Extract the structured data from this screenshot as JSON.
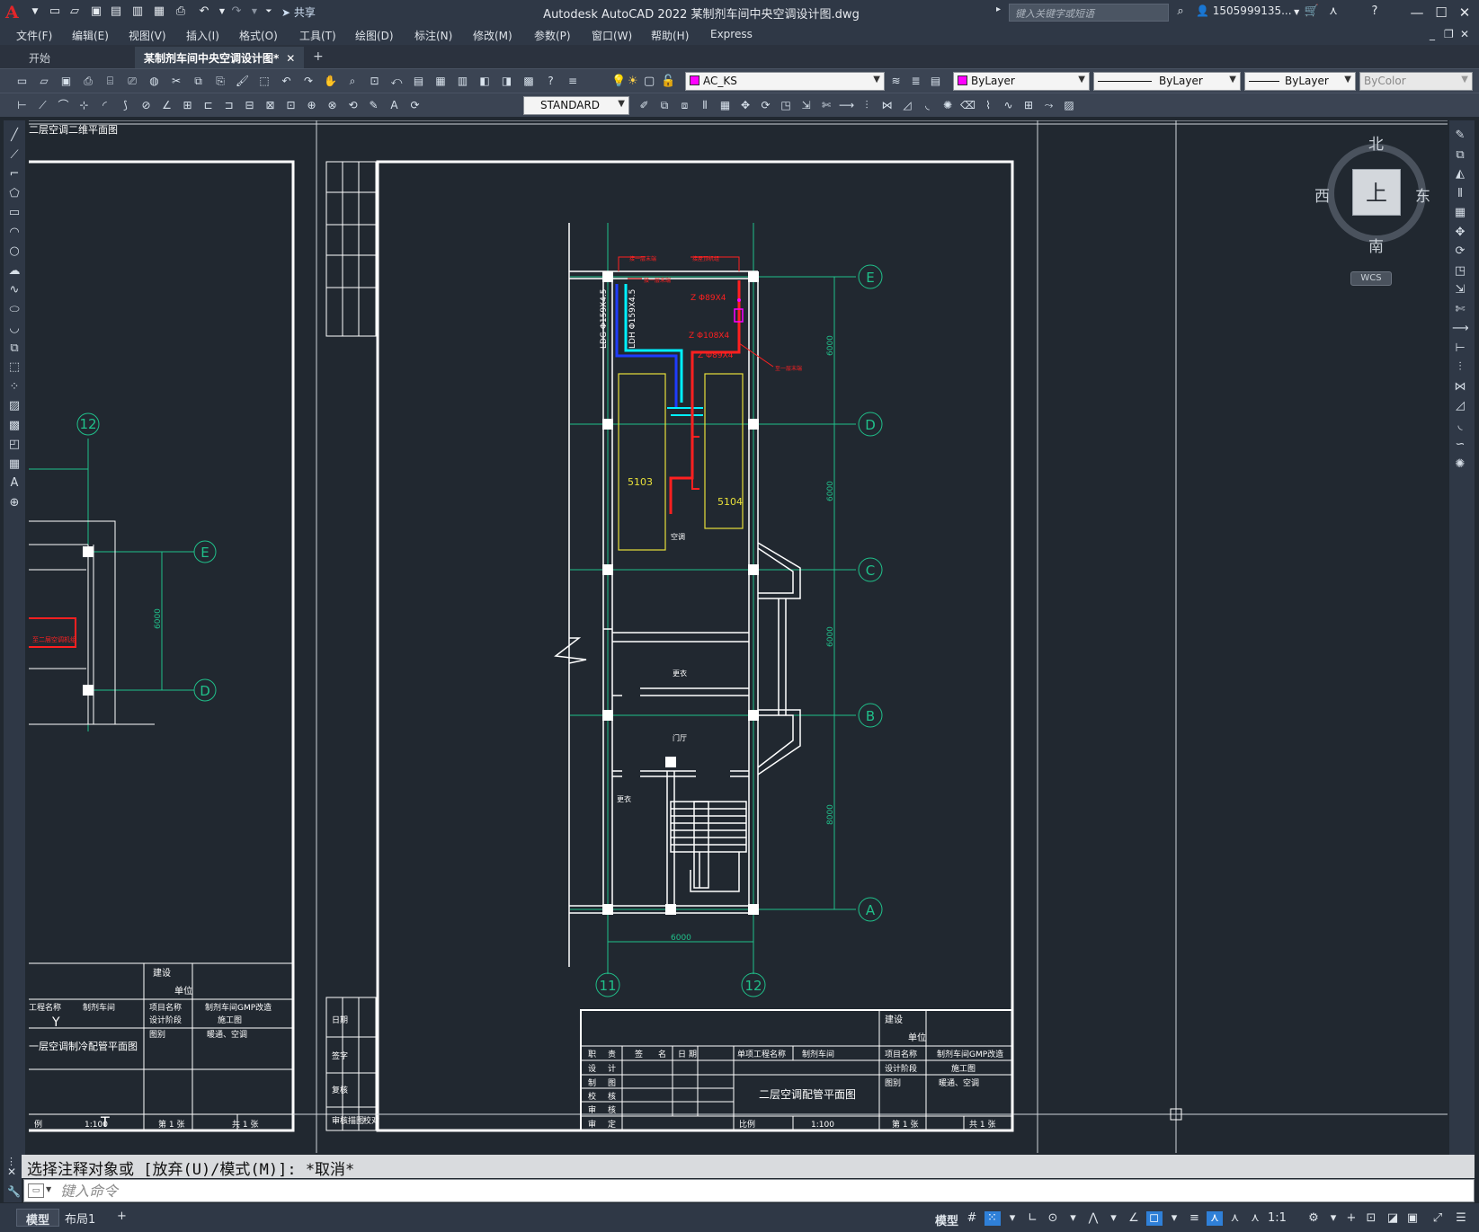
{
  "app": {
    "title": "Autodesk AutoCAD 2022    某制剂车间中央空调设计图.dwg",
    "share_label": "共享",
    "search_placeholder": "键入关键字或短语",
    "user_name": "1505999135..."
  },
  "menu": [
    "文件(F)",
    "编辑(E)",
    "视图(V)",
    "插入(I)",
    "格式(O)",
    "工具(T)",
    "绘图(D)",
    "标注(N)",
    "修改(M)",
    "参数(P)",
    "窗口(W)",
    "帮助(H)",
    "Express"
  ],
  "tabs": {
    "start": "开始",
    "drawing": "某制剂车间中央空调设计图*"
  },
  "properties": {
    "layer": "AC_KS",
    "color": "ByLayer",
    "linetype": "ByLayer",
    "lineweight": "ByLayer",
    "plotstyle": "ByColor",
    "textstyle": "STANDARD"
  },
  "viewcube": {
    "north": "北",
    "south": "南",
    "east": "东",
    "west": "西",
    "face": "上",
    "wcs": "WCS"
  },
  "drawing": {
    "grids": [
      "E",
      "D",
      "C",
      "B",
      "A"
    ],
    "axes": [
      "11",
      "12"
    ],
    "left_axis": "12",
    "left_grids": [
      "E",
      "D"
    ],
    "dims": [
      "6000",
      "6000",
      "6000",
      "8000"
    ],
    "width_dim": "6000",
    "left_dim": "6000",
    "rooms": [
      "5103",
      "5104",
      "空调",
      "更衣",
      "门厅",
      "更衣"
    ],
    "pipe_labels": [
      "LDG Φ159X4.5",
      "LDH Φ159X4.5",
      "Z Φ89X4",
      "Z Φ108X4",
      "Z Φ89X4"
    ],
    "annotations": [
      "接一层末端",
      "接屋顶机组",
      "接一层末端",
      "至一层末端"
    ],
    "left_annotations": [
      "至二层空调机组",
      "T",
      "Y"
    ],
    "top_cut_label": "二层空调二维平面图",
    "title_block": {
      "cols": [
        "职",
        "责",
        "签",
        "名",
        "日",
        "期"
      ],
      "left_column": [
        "设",
        "计",
        "制",
        "图",
        "校",
        "核",
        "审",
        "核",
        "审",
        "定"
      ],
      "project_label": "单项工程名称",
      "project_value": "制剂车间",
      "drawing_name": "二层空调配管平面图",
      "jianshe": "建设",
      "danwei": "单位",
      "xiangmu_label": "项目名称",
      "xiangmu_value": "制剂车间GMP改造",
      "jieduan_label": "设计阶段",
      "jieduan_value": "施工图",
      "tubie_label": "图别",
      "tubie_value": "暖通、空调",
      "scale_label": "比例",
      "scale_value": "1:100",
      "sheet_no": "第 1 张",
      "sheet_total": "共 1 张"
    },
    "left_title_block": {
      "project_label": "工程名称",
      "project_value": "制剂车间",
      "drawing_name": "一层空调制冷配管平面图",
      "scale_label": "例",
      "scale_value": "1:100",
      "xiangmu_label": "项目名称",
      "xiangmu_value": "制剂车间GMP改造",
      "jieduan_label": "设计阶段",
      "jieduan_value": "施工图",
      "tubie_label": "图别",
      "tubie_value": "暖通、空调",
      "jianshe": "建设",
      "danwei": "单位",
      "sheet_no": "第 1 张",
      "sheet_total": "共 1 张"
    },
    "side_strip": [
      "日期",
      "签字",
      "复核",
      "审核",
      "描图",
      "校对"
    ]
  },
  "command": {
    "history": "选择注释对象或 [放弃(U)/模式(M)]: *取消*",
    "placeholder": "键入命令"
  },
  "status": {
    "model_tab": "模型",
    "layout_tab": "布局1",
    "add_tab": "+",
    "model_text": "模型",
    "scale": "1:1"
  },
  "colors": {
    "background": "#212830",
    "grid_line": "#20c08a",
    "wall": "#ffffff",
    "pipe_red": "#ff2020",
    "pipe_cyan": "#00f0ff",
    "pipe_blue": "#1e3cff",
    "equipment": "#e8e03a",
    "magenta": "#ff00ff"
  }
}
